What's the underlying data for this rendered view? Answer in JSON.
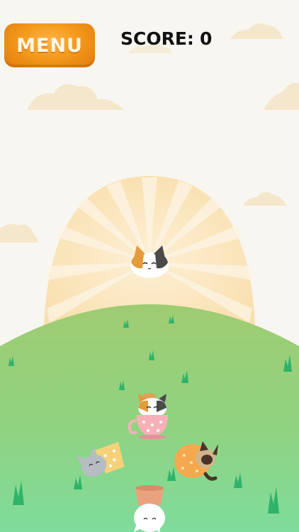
{
  "hud": {
    "menu_label": "MENU",
    "score_label": "SCORE:",
    "score_value": "0"
  },
  "colors": {
    "background": "#f8f6f1",
    "hill_top": "#9ccb74",
    "hill_bottom": "#7fd99a",
    "sun": "#fbe4b8",
    "menu_button": "#f49a1c"
  },
  "icons": [
    "cloud",
    "sun-rays",
    "grass-tuft",
    "calico-cat",
    "teacup-cat",
    "flowerpot-cat",
    "bucket-cat",
    "gray-cat",
    "siamese-cat"
  ]
}
